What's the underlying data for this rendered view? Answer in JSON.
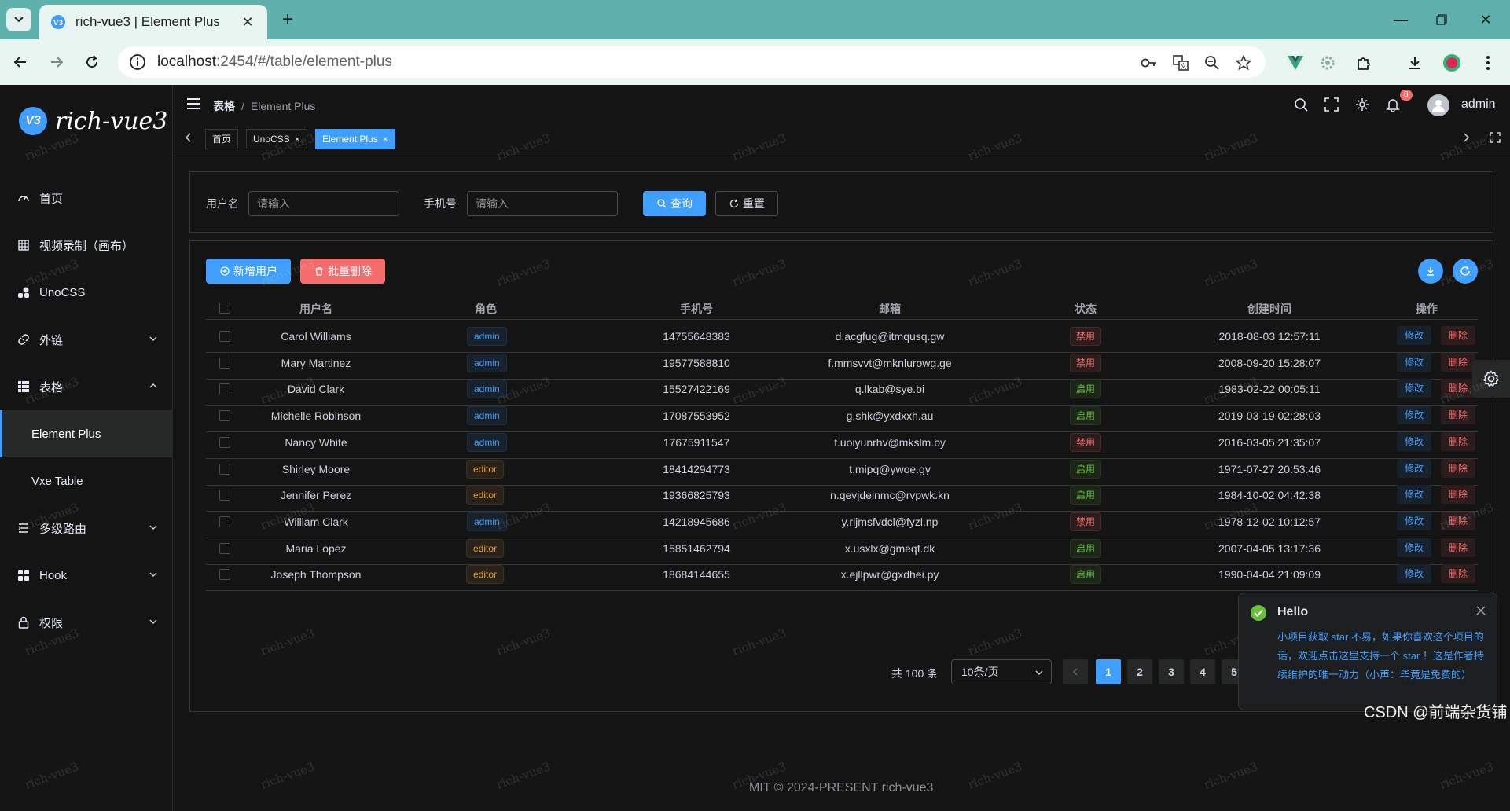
{
  "browser": {
    "tab_title": "rich-vue3 | Element Plus",
    "url_host": "localhost",
    "url_rest": ":2454/#/table/element-plus"
  },
  "app": {
    "logo_text": "rich-vue3",
    "logo_mark": "V3",
    "sidebar": {
      "items": [
        {
          "label": "首页",
          "icon": "dashboard-icon"
        },
        {
          "label": "视频录制（画布）",
          "icon": "grid-icon"
        },
        {
          "label": "UnoCSS",
          "icon": "shapes-icon"
        },
        {
          "label": "外链",
          "icon": "link-icon"
        },
        {
          "label": "表格",
          "icon": "table-icon"
        },
        {
          "label": "Element Plus"
        },
        {
          "label": "Vxe Table"
        },
        {
          "label": "多级路由",
          "icon": "list-icon"
        },
        {
          "label": "Hook",
          "icon": "apps-icon"
        },
        {
          "label": "权限",
          "icon": "lock-icon"
        }
      ]
    },
    "header": {
      "breadcrumb": [
        "表格",
        "Element Plus"
      ],
      "sep": "/",
      "notification_count": "8",
      "user": "admin"
    },
    "tags": [
      {
        "label": "首页",
        "closable": false
      },
      {
        "label": "UnoCSS",
        "closable": true
      },
      {
        "label": "Element Plus",
        "closable": true,
        "active": true
      }
    ],
    "search": {
      "username_label": "用户名",
      "username_placeholder": "请输入",
      "phone_label": "手机号",
      "phone_placeholder": "请输入",
      "query": "查询",
      "reset": "重置"
    },
    "table": {
      "add_user": "新增用户",
      "batch_delete": "批量删除",
      "columns": [
        "用户名",
        "角色",
        "手机号",
        "邮箱",
        "状态",
        "创建时间",
        "操作"
      ],
      "edit": "修改",
      "delete": "删除",
      "rows": [
        {
          "name": "Carol Williams",
          "role": "admin",
          "phone": "14755648383",
          "email": "d.acgfug@itmqusq.gw",
          "status": "禁用",
          "created": "2018-08-03 12:57:11"
        },
        {
          "name": "Mary Martinez",
          "role": "admin",
          "phone": "19577588810",
          "email": "f.mmsvvt@mknlurowg.ge",
          "status": "禁用",
          "created": "2008-09-20 15:28:07"
        },
        {
          "name": "David Clark",
          "role": "admin",
          "phone": "15527422169",
          "email": "q.lkab@sye.bi",
          "status": "启用",
          "created": "1983-02-22 00:05:11"
        },
        {
          "name": "Michelle Robinson",
          "role": "admin",
          "phone": "17087553952",
          "email": "g.shk@yxdxxh.au",
          "status": "启用",
          "created": "2019-03-19 02:28:03"
        },
        {
          "name": "Nancy White",
          "role": "admin",
          "phone": "17675911547",
          "email": "f.uoiyunrhv@mkslm.by",
          "status": "禁用",
          "created": "2016-03-05 21:35:07"
        },
        {
          "name": "Shirley Moore",
          "role": "editor",
          "phone": "18414294773",
          "email": "t.mipq@ywoe.gy",
          "status": "启用",
          "created": "1971-07-27 20:53:46"
        },
        {
          "name": "Jennifer Perez",
          "role": "editor",
          "phone": "19366825793",
          "email": "n.qevjdelnmc@rvpwk.kn",
          "status": "启用",
          "created": "1984-10-02 04:42:38"
        },
        {
          "name": "William Clark",
          "role": "admin",
          "phone": "14218945686",
          "email": "y.rljmsfvdcl@fyzl.np",
          "status": "禁用",
          "created": "1978-12-02 10:12:57"
        },
        {
          "name": "Maria Lopez",
          "role": "editor",
          "phone": "15851462794",
          "email": "x.usxlx@gmeqf.dk",
          "status": "启用",
          "created": "2007-04-05 13:17:36"
        },
        {
          "name": "Joseph Thompson",
          "role": "editor",
          "phone": "18684144655",
          "email": "x.ejllpwr@gxdhei.py",
          "status": "启用",
          "created": "1990-04-04 21:09:09"
        }
      ]
    },
    "pagination": {
      "total": "共 100 条",
      "page_size": "10条/页",
      "pages": [
        "1",
        "2",
        "3",
        "4",
        "5"
      ],
      "current": "1"
    },
    "footer": "MIT © 2024-PRESENT rich-vue3",
    "notification": {
      "title": "Hello",
      "message": "小项目获取 star 不易，如果你喜欢这个项目的话，欢迎点击这里支持一个 star ！这是作者持续维护的唯一动力（小声：毕竟是免费的）"
    },
    "watermark": "rich-vue3",
    "csdn": "CSDN @前端杂货铺"
  },
  "colors": {
    "primary": "#409eff",
    "danger": "#f56c6c",
    "success": "#67c23a",
    "warning": "#e6a23c",
    "chrome": "#5fb1ad"
  }
}
